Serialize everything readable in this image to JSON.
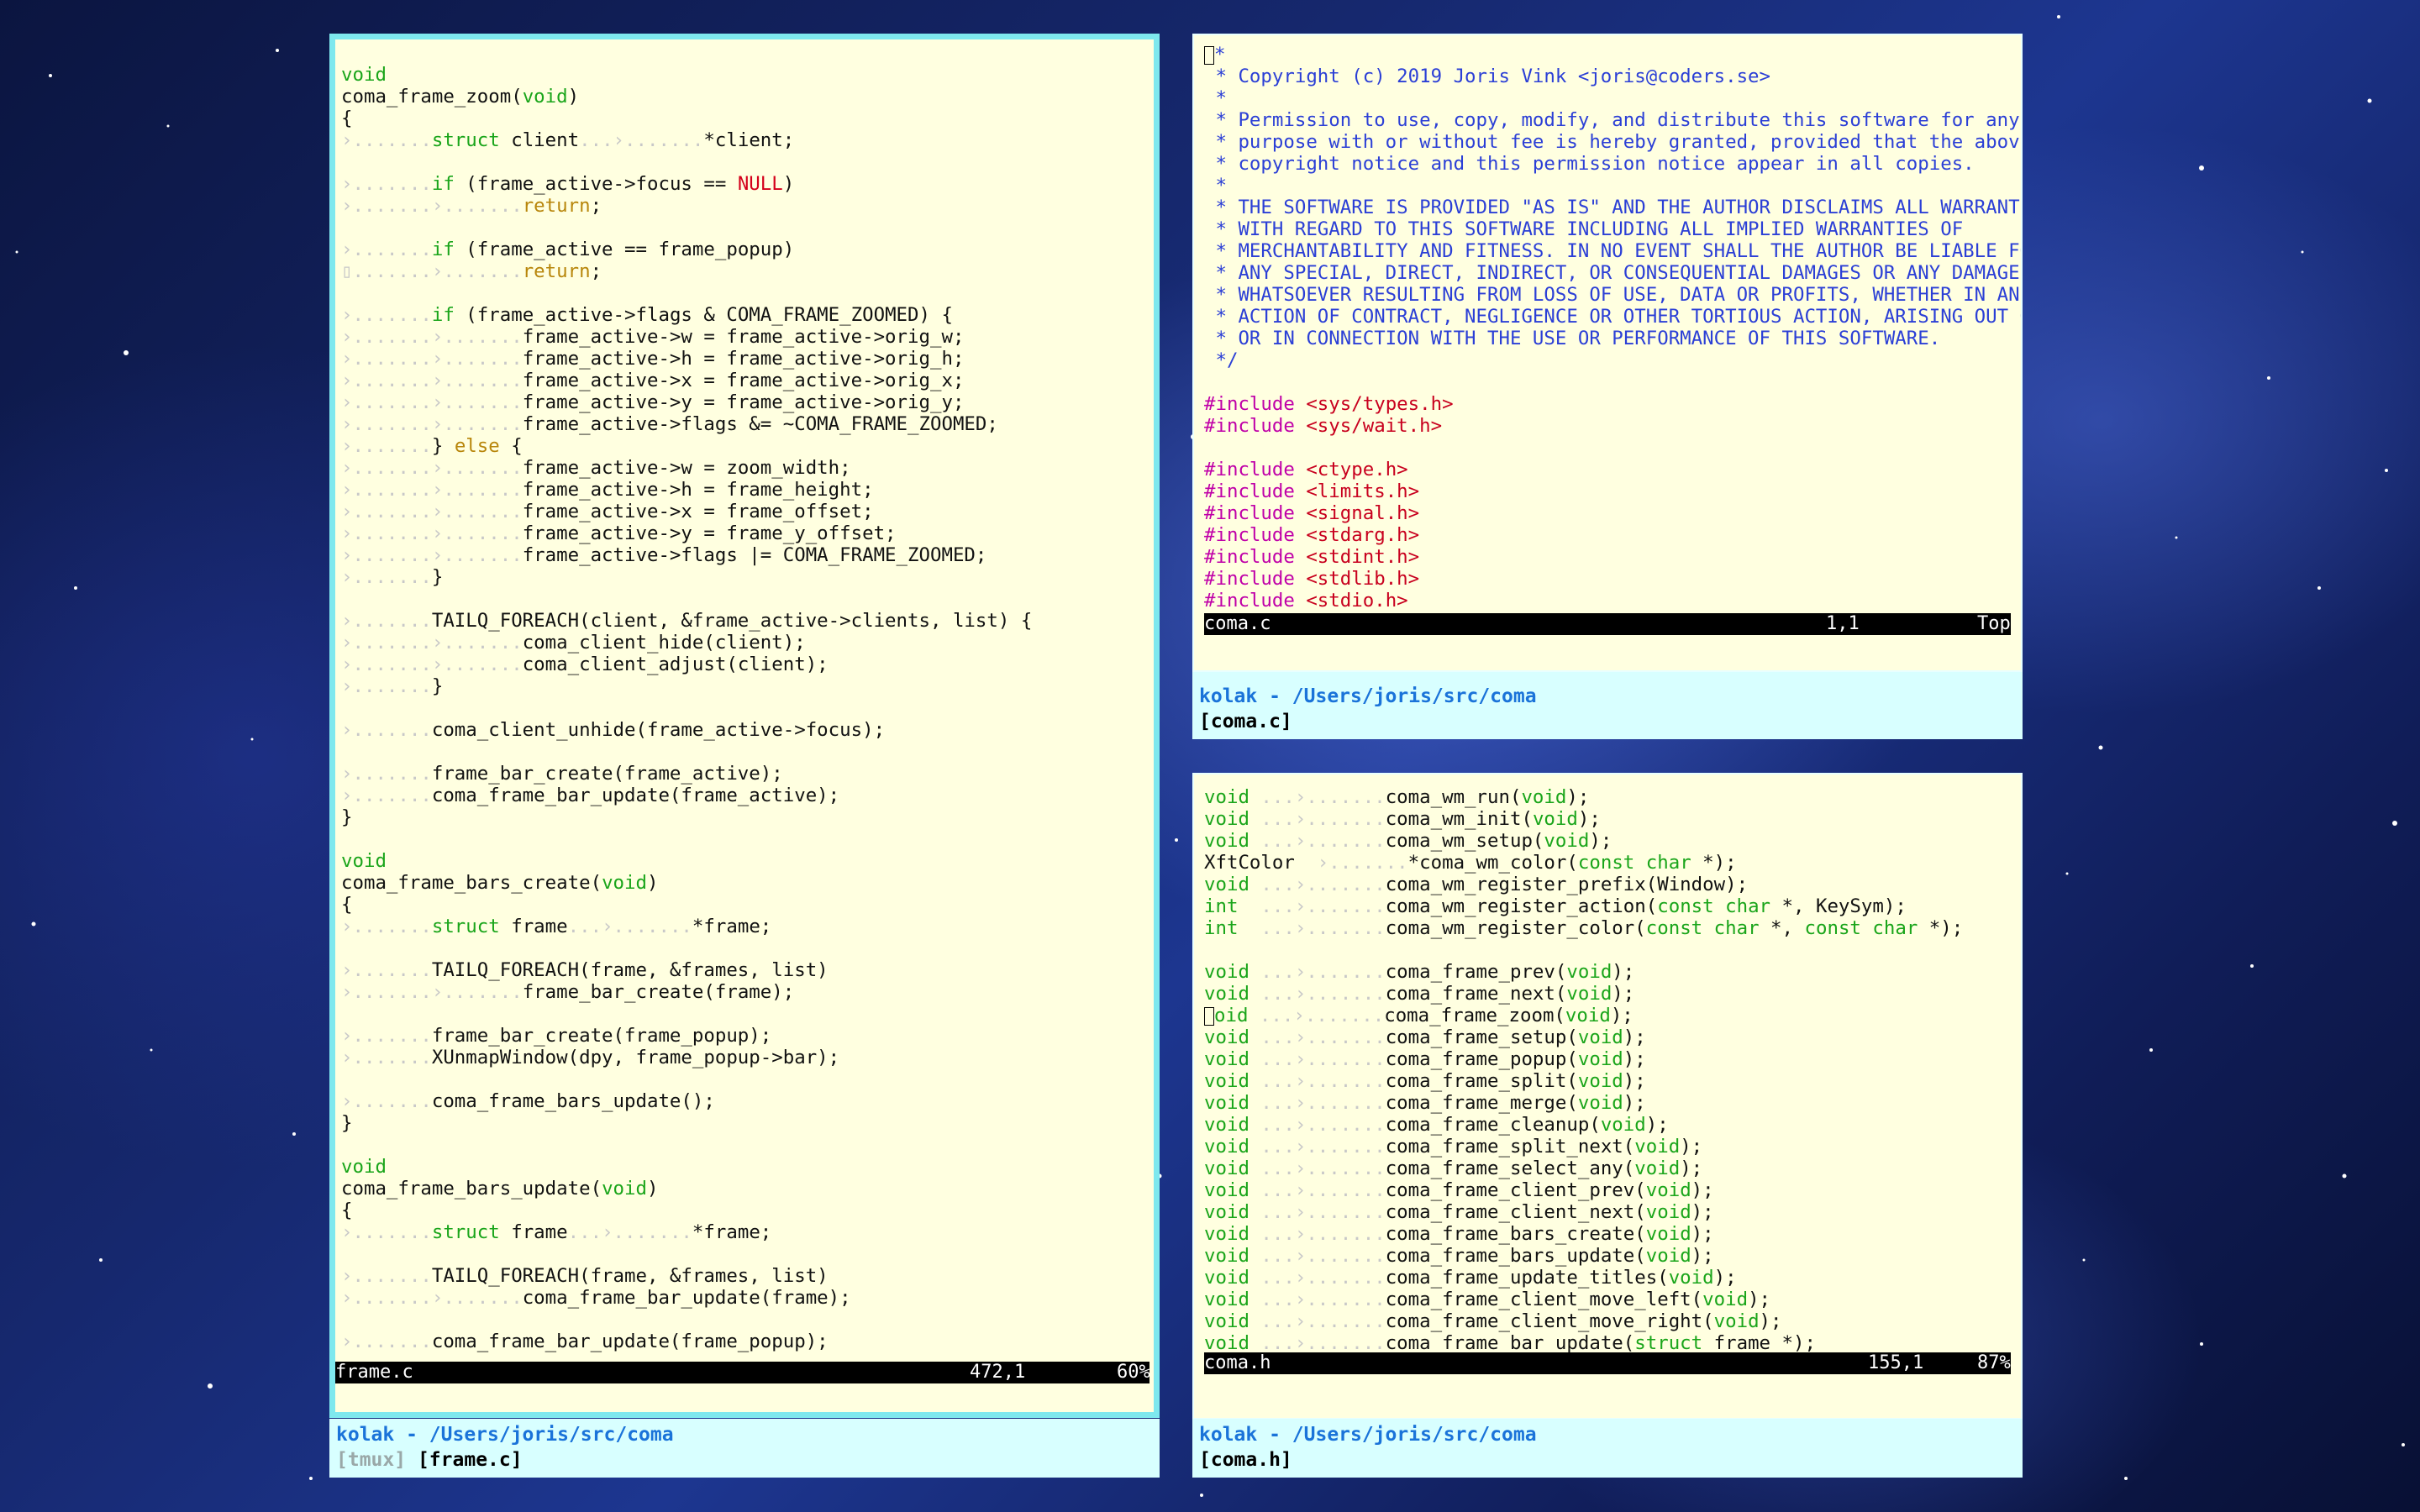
{
  "panes": {
    "left": {
      "status": {
        "file": "frame.c",
        "pos": "472,1",
        "pct": "60%"
      },
      "footer": {
        "host": "kolak - /Users/joris/src/coma",
        "tmux": "[tmux]",
        "file": "[frame.c]"
      }
    },
    "top_right": {
      "status": {
        "file": "coma.c",
        "pos": "1,1",
        "pct": "Top"
      },
      "footer": {
        "host": "kolak - /Users/joris/src/coma",
        "file": "[coma.c]"
      }
    },
    "bottom_right": {
      "status": {
        "file": "coma.h",
        "pos": "155,1",
        "pct": "87%"
      },
      "footer": {
        "host": "kolak - /Users/joris/src/coma",
        "file": "[coma.h]"
      }
    }
  },
  "code": {
    "left": [
      [],
      [
        [
          "k",
          "void"
        ]
      ],
      [
        [
          "t",
          "coma_frame_zoom("
        ],
        [
          "k",
          "void"
        ],
        [
          "t",
          ")"
        ]
      ],
      [
        [
          "t",
          "{"
        ]
      ],
      [
        [
          "g",
          "›.......",
          ""
        ],
        [
          "k",
          "struct"
        ],
        [
          "t",
          " client"
        ],
        [
          "g",
          "...›......."
        ],
        [
          "t",
          "*client;"
        ]
      ],
      [],
      [
        [
          "g",
          "›......."
        ],
        [
          "k",
          "if"
        ],
        [
          "t",
          " (frame_active->focus == "
        ],
        [
          "r",
          "NULL"
        ],
        [
          "t",
          ")"
        ]
      ],
      [
        [
          "g",
          "›.......›......."
        ],
        [
          "y",
          "return"
        ],
        [
          "t",
          ";"
        ]
      ],
      [],
      [
        [
          "g",
          "›......."
        ],
        [
          "k",
          "if"
        ],
        [
          "t",
          " (frame_active == frame_popup)"
        ]
      ],
      [
        [
          "g",
          "▯.......›......."
        ],
        [
          "y",
          "return"
        ],
        [
          "t",
          ";"
        ]
      ],
      [],
      [
        [
          "g",
          "›......."
        ],
        [
          "k",
          "if"
        ],
        [
          "t",
          " (frame_active->flags & COMA_FRAME_ZOOMED) {"
        ]
      ],
      [
        [
          "g",
          "›.......›......."
        ],
        [
          "t",
          "frame_active->w = frame_active->orig_w;"
        ]
      ],
      [
        [
          "g",
          "›.......›......."
        ],
        [
          "t",
          "frame_active->h = frame_active->orig_h;"
        ]
      ],
      [
        [
          "g",
          "›.......›......."
        ],
        [
          "t",
          "frame_active->x = frame_active->orig_x;"
        ]
      ],
      [
        [
          "g",
          "›.......›......."
        ],
        [
          "t",
          "frame_active->y = frame_active->orig_y;"
        ]
      ],
      [
        [
          "g",
          "›.......›......."
        ],
        [
          "t",
          "frame_active->flags &= ~COMA_FRAME_ZOOMED;"
        ]
      ],
      [
        [
          "g",
          "›......."
        ],
        [
          "t",
          "} "
        ],
        [
          "y",
          "else"
        ],
        [
          "t",
          " {"
        ]
      ],
      [
        [
          "g",
          "›.......›......."
        ],
        [
          "t",
          "frame_active->w = zoom_width;"
        ]
      ],
      [
        [
          "g",
          "›.......›......."
        ],
        [
          "t",
          "frame_active->h = frame_height;"
        ]
      ],
      [
        [
          "g",
          "›.......›......."
        ],
        [
          "t",
          "frame_active->x = frame_offset;"
        ]
      ],
      [
        [
          "g",
          "›.......›......."
        ],
        [
          "t",
          "frame_active->y = frame_y_offset;"
        ]
      ],
      [
        [
          "g",
          "›.......›......."
        ],
        [
          "t",
          "frame_active->flags |= COMA_FRAME_ZOOMED;"
        ]
      ],
      [
        [
          "g",
          "›......."
        ],
        [
          "t",
          "}"
        ]
      ],
      [],
      [
        [
          "g",
          "›......."
        ],
        [
          "t",
          "TAILQ_FOREACH(client, &frame_active->clients, list) {"
        ]
      ],
      [
        [
          "g",
          "›.......›......."
        ],
        [
          "t",
          "coma_client_hide(client);"
        ]
      ],
      [
        [
          "g",
          "›.......›......."
        ],
        [
          "t",
          "coma_client_adjust(client);"
        ]
      ],
      [
        [
          "g",
          "›......."
        ],
        [
          "t",
          "}"
        ]
      ],
      [],
      [
        [
          "g",
          "›......."
        ],
        [
          "t",
          "coma_client_unhide(frame_active->focus);"
        ]
      ],
      [],
      [
        [
          "g",
          "›......."
        ],
        [
          "t",
          "frame_bar_create(frame_active);"
        ]
      ],
      [
        [
          "g",
          "›......."
        ],
        [
          "t",
          "coma_frame_bar_update(frame_active);"
        ]
      ],
      [
        [
          "t",
          "}"
        ]
      ],
      [],
      [
        [
          "k",
          "void"
        ]
      ],
      [
        [
          "t",
          "coma_frame_bars_create("
        ],
        [
          "k",
          "void"
        ],
        [
          "t",
          ")"
        ]
      ],
      [
        [
          "t",
          "{"
        ]
      ],
      [
        [
          "g",
          "›......."
        ],
        [
          "k",
          "struct"
        ],
        [
          "t",
          " frame"
        ],
        [
          "g",
          "...›......."
        ],
        [
          "t",
          "*frame;"
        ]
      ],
      [],
      [
        [
          "g",
          "›......."
        ],
        [
          "t",
          "TAILQ_FOREACH(frame, &frames, list)"
        ]
      ],
      [
        [
          "g",
          "›.......›......."
        ],
        [
          "t",
          "frame_bar_create(frame);"
        ]
      ],
      [],
      [
        [
          "g",
          "›......."
        ],
        [
          "t",
          "frame_bar_create(frame_popup);"
        ]
      ],
      [
        [
          "g",
          "›......."
        ],
        [
          "t",
          "XUnmapWindow(dpy, frame_popup->bar);"
        ]
      ],
      [],
      [
        [
          "g",
          "›......."
        ],
        [
          "t",
          "coma_frame_bars_update();"
        ]
      ],
      [
        [
          "t",
          "}"
        ]
      ],
      [],
      [
        [
          "k",
          "void"
        ]
      ],
      [
        [
          "t",
          "coma_frame_bars_update("
        ],
        [
          "k",
          "void"
        ],
        [
          "t",
          ")"
        ]
      ],
      [
        [
          "t",
          "{"
        ]
      ],
      [
        [
          "g",
          "›......."
        ],
        [
          "k",
          "struct"
        ],
        [
          "t",
          " frame"
        ],
        [
          "g",
          "...›......."
        ],
        [
          "t",
          "*frame;"
        ]
      ],
      [],
      [
        [
          "g",
          "›......."
        ],
        [
          "t",
          "TAILQ_FOREACH(frame, &frames, list)"
        ]
      ],
      [
        [
          "g",
          "›.......›......."
        ],
        [
          "t",
          "coma_frame_bar_update(frame);"
        ]
      ],
      [],
      [
        [
          "g",
          "›......."
        ],
        [
          "t",
          "coma_frame_bar_update(frame_popup);"
        ]
      ]
    ],
    "top_right": [
      [
        [
          "cur",
          ""
        ],
        [
          "c",
          "*"
        ]
      ],
      [
        [
          "c",
          " * Copyright (c) 2019 Joris Vink <joris@coders.se>"
        ]
      ],
      [
        [
          "c",
          " *"
        ]
      ],
      [
        [
          "c",
          " * Permission to use, copy, modify, and distribute this software for any"
        ]
      ],
      [
        [
          "c",
          " * purpose with or without fee is hereby granted, provided that the above"
        ]
      ],
      [
        [
          "c",
          " * copyright notice and this permission notice appear in all copies."
        ]
      ],
      [
        [
          "c",
          " *"
        ]
      ],
      [
        [
          "c",
          " * THE SOFTWARE IS PROVIDED \"AS IS\" AND THE AUTHOR DISCLAIMS ALL WARRANTIES"
        ]
      ],
      [
        [
          "c",
          " * WITH REGARD TO THIS SOFTWARE INCLUDING ALL IMPLIED WARRANTIES OF"
        ]
      ],
      [
        [
          "c",
          " * MERCHANTABILITY AND FITNESS. IN NO EVENT SHALL THE AUTHOR BE LIABLE FOR"
        ]
      ],
      [
        [
          "c",
          " * ANY SPECIAL, DIRECT, INDIRECT, OR CONSEQUENTIAL DAMAGES OR ANY DAMAGES"
        ]
      ],
      [
        [
          "c",
          " * WHATSOEVER RESULTING FROM LOSS OF USE, DATA OR PROFITS, WHETHER IN AN"
        ]
      ],
      [
        [
          "c",
          " * ACTION OF CONTRACT, NEGLIGENCE OR OTHER TORTIOUS ACTION, ARISING OUT OF"
        ]
      ],
      [
        [
          "c",
          " * OR IN CONNECTION WITH THE USE OR PERFORMANCE OF THIS SOFTWARE."
        ]
      ],
      [
        [
          "c",
          " */"
        ]
      ],
      [],
      [
        [
          "p",
          "#include "
        ],
        [
          "s",
          "<sys/types.h>"
        ]
      ],
      [
        [
          "p",
          "#include "
        ],
        [
          "s",
          "<sys/wait.h>"
        ]
      ],
      [],
      [
        [
          "p",
          "#include "
        ],
        [
          "s",
          "<ctype.h>"
        ]
      ],
      [
        [
          "p",
          "#include "
        ],
        [
          "s",
          "<limits.h>"
        ]
      ],
      [
        [
          "p",
          "#include "
        ],
        [
          "s",
          "<signal.h>"
        ]
      ],
      [
        [
          "p",
          "#include "
        ],
        [
          "s",
          "<stdarg.h>"
        ]
      ],
      [
        [
          "p",
          "#include "
        ],
        [
          "s",
          "<stdint.h>"
        ]
      ],
      [
        [
          "p",
          "#include "
        ],
        [
          "s",
          "<stdlib.h>"
        ]
      ],
      [
        [
          "p",
          "#include "
        ],
        [
          "s",
          "<stdio.h>"
        ]
      ]
    ],
    "bottom_right": [
      [
        [
          "k",
          "void"
        ],
        [
          "g",
          " ...›......."
        ],
        [
          "t",
          "coma_wm_run("
        ],
        [
          "k",
          "void"
        ],
        [
          "t",
          ");"
        ]
      ],
      [
        [
          "k",
          "void"
        ],
        [
          "g",
          " ...›......."
        ],
        [
          "t",
          "coma_wm_init("
        ],
        [
          "k",
          "void"
        ],
        [
          "t",
          ");"
        ]
      ],
      [
        [
          "k",
          "void"
        ],
        [
          "g",
          " ...›......."
        ],
        [
          "t",
          "coma_wm_setup("
        ],
        [
          "k",
          "void"
        ],
        [
          "t",
          ");"
        ]
      ],
      [
        [
          "t",
          "XftColor"
        ],
        [
          "g",
          "  ›......."
        ],
        [
          "t",
          "*coma_wm_color("
        ],
        [
          "k",
          "const char"
        ],
        [
          "t",
          " *);"
        ]
      ],
      [
        [
          "k",
          "void"
        ],
        [
          "g",
          " ...›......."
        ],
        [
          "t",
          "coma_wm_register_prefix(Window);"
        ]
      ],
      [
        [
          "k",
          "int"
        ],
        [
          "g",
          "  ...›......."
        ],
        [
          "t",
          "coma_wm_register_action("
        ],
        [
          "k",
          "const char"
        ],
        [
          "t",
          " *, KeySym);"
        ]
      ],
      [
        [
          "k",
          "int"
        ],
        [
          "g",
          "  ...›......."
        ],
        [
          "t",
          "coma_wm_register_color("
        ],
        [
          "k",
          "const char"
        ],
        [
          "t",
          " *, "
        ],
        [
          "k",
          "const char"
        ],
        [
          "t",
          " *);"
        ]
      ],
      [],
      [
        [
          "k",
          "void"
        ],
        [
          "g",
          " ...›......."
        ],
        [
          "t",
          "coma_frame_prev("
        ],
        [
          "k",
          "void"
        ],
        [
          "t",
          ");"
        ]
      ],
      [
        [
          "k",
          "void"
        ],
        [
          "g",
          " ...›......."
        ],
        [
          "t",
          "coma_frame_next("
        ],
        [
          "k",
          "void"
        ],
        [
          "t",
          ");"
        ]
      ],
      [
        [
          "cur",
          ""
        ],
        [
          "k",
          "oid"
        ],
        [
          "g",
          " ...›......."
        ],
        [
          "t",
          "coma_frame_zoom("
        ],
        [
          "k",
          "void"
        ],
        [
          "t",
          ");"
        ]
      ],
      [
        [
          "k",
          "void"
        ],
        [
          "g",
          " ...›......."
        ],
        [
          "t",
          "coma_frame_setup("
        ],
        [
          "k",
          "void"
        ],
        [
          "t",
          ");"
        ]
      ],
      [
        [
          "k",
          "void"
        ],
        [
          "g",
          " ...›......."
        ],
        [
          "t",
          "coma_frame_popup("
        ],
        [
          "k",
          "void"
        ],
        [
          "t",
          ");"
        ]
      ],
      [
        [
          "k",
          "void"
        ],
        [
          "g",
          " ...›......."
        ],
        [
          "t",
          "coma_frame_split("
        ],
        [
          "k",
          "void"
        ],
        [
          "t",
          ");"
        ]
      ],
      [
        [
          "k",
          "void"
        ],
        [
          "g",
          " ...›......."
        ],
        [
          "t",
          "coma_frame_merge("
        ],
        [
          "k",
          "void"
        ],
        [
          "t",
          ");"
        ]
      ],
      [
        [
          "k",
          "void"
        ],
        [
          "g",
          " ...›......."
        ],
        [
          "t",
          "coma_frame_cleanup("
        ],
        [
          "k",
          "void"
        ],
        [
          "t",
          ");"
        ]
      ],
      [
        [
          "k",
          "void"
        ],
        [
          "g",
          " ...›......."
        ],
        [
          "t",
          "coma_frame_split_next("
        ],
        [
          "k",
          "void"
        ],
        [
          "t",
          ");"
        ]
      ],
      [
        [
          "k",
          "void"
        ],
        [
          "g",
          " ...›......."
        ],
        [
          "t",
          "coma_frame_select_any("
        ],
        [
          "k",
          "void"
        ],
        [
          "t",
          ");"
        ]
      ],
      [
        [
          "k",
          "void"
        ],
        [
          "g",
          " ...›......."
        ],
        [
          "t",
          "coma_frame_client_prev("
        ],
        [
          "k",
          "void"
        ],
        [
          "t",
          ");"
        ]
      ],
      [
        [
          "k",
          "void"
        ],
        [
          "g",
          " ...›......."
        ],
        [
          "t",
          "coma_frame_client_next("
        ],
        [
          "k",
          "void"
        ],
        [
          "t",
          ");"
        ]
      ],
      [
        [
          "k",
          "void"
        ],
        [
          "g",
          " ...›......."
        ],
        [
          "t",
          "coma_frame_bars_create("
        ],
        [
          "k",
          "void"
        ],
        [
          "t",
          ");"
        ]
      ],
      [
        [
          "k",
          "void"
        ],
        [
          "g",
          " ...›......."
        ],
        [
          "t",
          "coma_frame_bars_update("
        ],
        [
          "k",
          "void"
        ],
        [
          "t",
          ");"
        ]
      ],
      [
        [
          "k",
          "void"
        ],
        [
          "g",
          " ...›......."
        ],
        [
          "t",
          "coma_frame_update_titles("
        ],
        [
          "k",
          "void"
        ],
        [
          "t",
          ");"
        ]
      ],
      [
        [
          "k",
          "void"
        ],
        [
          "g",
          " ...›......."
        ],
        [
          "t",
          "coma_frame_client_move_left("
        ],
        [
          "k",
          "void"
        ],
        [
          "t",
          ");"
        ]
      ],
      [
        [
          "k",
          "void"
        ],
        [
          "g",
          " ...›......."
        ],
        [
          "t",
          "coma_frame_client_move_right("
        ],
        [
          "k",
          "void"
        ],
        [
          "t",
          ");"
        ]
      ],
      [
        [
          "k",
          "void"
        ],
        [
          "g",
          " ...›......."
        ],
        [
          "t",
          "coma_frame_bar_update("
        ],
        [
          "k",
          "struct"
        ],
        [
          "t",
          " frame *);"
        ]
      ]
    ]
  }
}
